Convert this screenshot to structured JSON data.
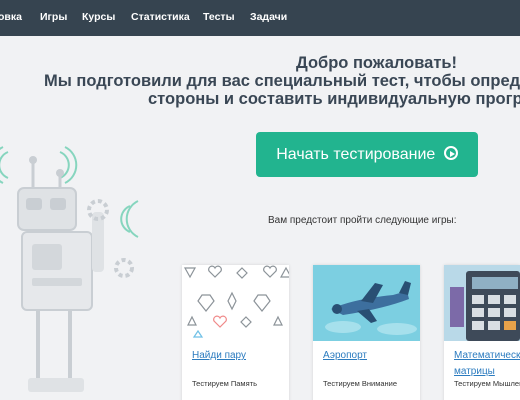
{
  "nav": {
    "items": [
      "овка",
      "Игры",
      "Курсы",
      "Статистика",
      "Тесты",
      "Задачи"
    ]
  },
  "welcome": {
    "line1": "Добро пожаловать!",
    "line2": "Мы подготовили для вас специальный тест, чтобы определить в",
    "line3": "стороны и составить индивидуальную программу"
  },
  "start_button": {
    "label": "Начать тестирование"
  },
  "games_intro": "Вам предстоит пройти следующие игры:",
  "games": [
    {
      "title": "Найди пару",
      "title_line2": "",
      "subtitle": "Тестируем Память",
      "image_icon": "shapes-pattern"
    },
    {
      "title": "Аэропорт",
      "title_line2": "",
      "subtitle": "Тестируем Внимание",
      "image_icon": "airplane"
    },
    {
      "title": "Математическ",
      "title_line2": "матрицы",
      "subtitle": "Тестируем Мышлен",
      "image_icon": "calculator"
    }
  ],
  "colors": {
    "nav_bg": "#364450",
    "accent": "#22b48f",
    "link": "#2b7bbf"
  }
}
